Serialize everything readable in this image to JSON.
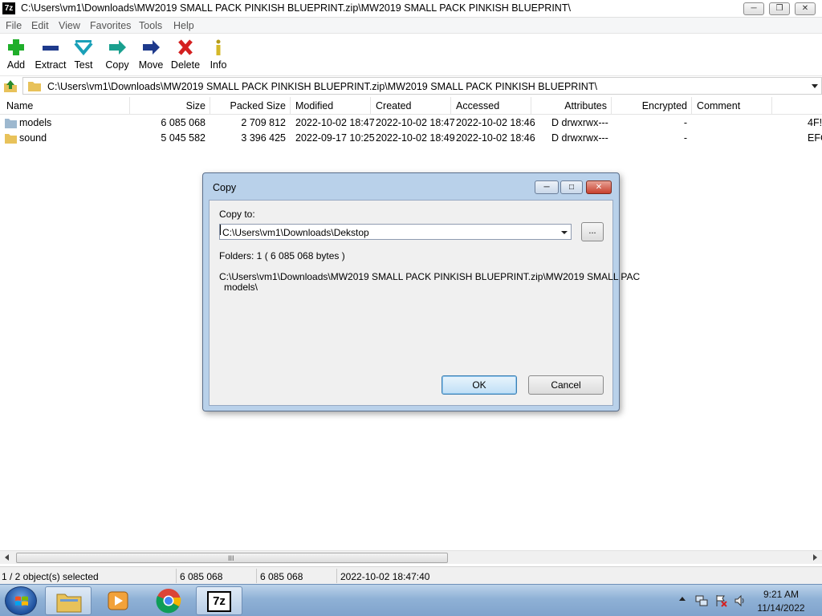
{
  "window": {
    "app_icon_label": "7z",
    "title": "C:\\Users\\vm1\\Downloads\\MW2019 SMALL PACK PINKISH BLUEPRINT.zip\\MW2019 SMALL PACK PINKISH BLUEPRINT\\"
  },
  "menu": [
    "File",
    "Edit",
    "View",
    "Favorites",
    "Tools",
    "Help"
  ],
  "toolbar": {
    "add": "Add",
    "extract": "Extract",
    "test": "Test",
    "copy": "Copy",
    "move": "Move",
    "delete": "Delete",
    "info": "Info"
  },
  "address": {
    "path": "C:\\Users\\vm1\\Downloads\\MW2019 SMALL PACK PINKISH BLUEPRINT.zip\\MW2019 SMALL PACK PINKISH BLUEPRINT\\"
  },
  "columns": {
    "name": "Name",
    "size": "Size",
    "packed_size": "Packed Size",
    "modified": "Modified",
    "created": "Created",
    "accessed": "Accessed",
    "attributes": "Attributes",
    "encrypted": "Encrypted",
    "comment": "Comment"
  },
  "rows": [
    {
      "name": "models",
      "size": "6 085 068",
      "packed_size": "2 709 812",
      "modified": "2022-10-02 18:47",
      "created": "2022-10-02 18:47",
      "accessed": "2022-10-02 18:46",
      "attributes": "D drwxrwx---",
      "encrypted": "-",
      "crc_partial": "4F!"
    },
    {
      "name": "sound",
      "size": "5 045 582",
      "packed_size": "3 396 425",
      "modified": "2022-09-17 10:25",
      "created": "2022-10-02 18:49",
      "accessed": "2022-10-02 18:46",
      "attributes": "D drwxrwx---",
      "encrypted": "-",
      "crc_partial": "EFC"
    }
  ],
  "scrollbar": {
    "grip": "III"
  },
  "status": {
    "selected": "1 / 2 object(s) selected",
    "size": "6 085 068",
    "packed": "6 085 068",
    "date": "2022-10-02 18:47:40"
  },
  "dialog": {
    "title": "Copy",
    "copy_to_label": "Copy to:",
    "destination_value": "C:\\Users\\vm1\\Downloads\\Dekstop",
    "browse_label": "...",
    "folders_info": "Folders: 1    ( 6 085 068 bytes )",
    "source_path_line1": "C:\\Users\\vm1\\Downloads\\MW2019 SMALL PACK PINKISH BLUEPRINT.zip\\MW2019 SMALL PAC",
    "source_path_line2": "models\\",
    "ok_label": "OK",
    "cancel_label": "Cancel"
  },
  "taskbar": {
    "sevenzip_label": "7z",
    "clock_time": "9:21 AM",
    "clock_date": "11/14/2022"
  },
  "colors": {
    "dialog_frame": "#b9d1ea",
    "taskbar": "#8fb1d6",
    "add_icon": "#1fae2a",
    "delete_icon": "#d42020",
    "folder": "#e8c25a"
  }
}
